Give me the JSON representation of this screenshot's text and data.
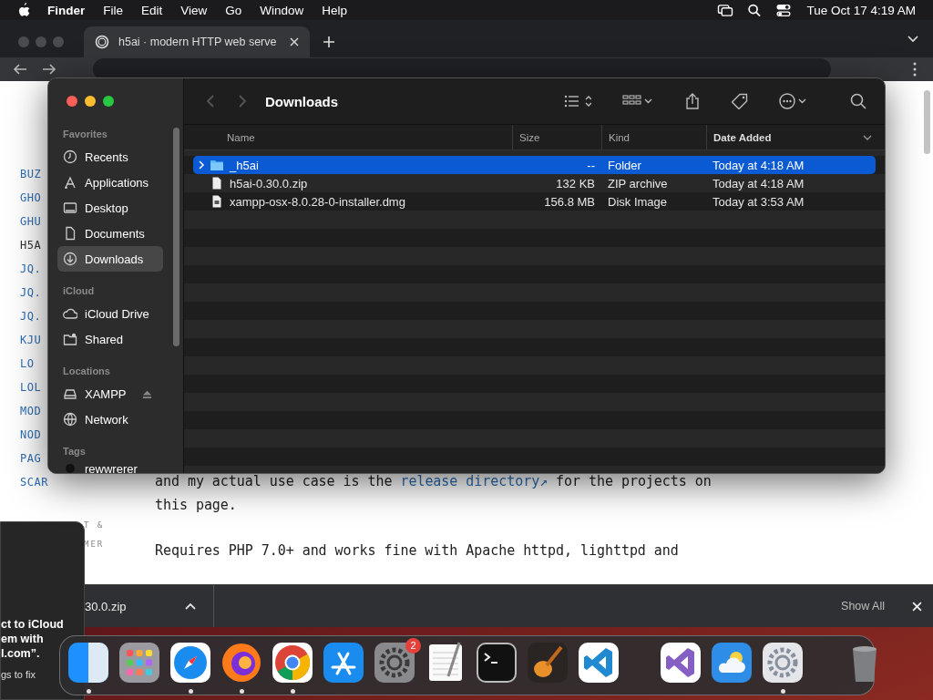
{
  "menubar": {
    "app": "Finder",
    "menus": [
      "File",
      "Edit",
      "View",
      "Go",
      "Window",
      "Help"
    ],
    "clock": "Tue Oct 17  4:19 AM"
  },
  "browser": {
    "tabs": [
      {
        "title": "h5ai · modern HTTP web serve",
        "selected": true
      }
    ],
    "nav_links": [
      {
        "label": "BUZ",
        "selected": false
      },
      {
        "label": "GHO",
        "selected": false
      },
      {
        "label": "GHU",
        "selected": false
      },
      {
        "label": "H5A",
        "selected": true
      },
      {
        "label": "JQ.",
        "selected": false
      },
      {
        "label": "JQ.",
        "selected": false
      },
      {
        "label": "JQ.",
        "selected": false
      },
      {
        "label": "KJU",
        "selected": false
      },
      {
        "label": "LO",
        "selected": false
      },
      {
        "label": "LOL",
        "selected": false
      },
      {
        "label": "MOD",
        "selected": false
      },
      {
        "label": "NOD",
        "selected": false
      },
      {
        "label": "PAG",
        "selected": false
      },
      {
        "label": "SCAR",
        "selected": false
      }
    ],
    "footer_links": [
      "T &",
      "MER"
    ],
    "paragraphs": [
      {
        "before": "and my actual use case is the ",
        "link": "release directory↗",
        "after": " for the projects on this page."
      },
      {
        "before": "Requires PHP 7.0+ and works fine with Apache httpd, lighttpd and"
      }
    ],
    "download_bar": {
      "file": "30.0.zip",
      "show_all": "Show All"
    }
  },
  "finder": {
    "title": "Downloads",
    "sidebar": [
      {
        "heading": "Favorites",
        "items": [
          {
            "label": "Recents",
            "kind": "recents",
            "selected": false
          },
          {
            "label": "Applications",
            "kind": "applications",
            "selected": false
          },
          {
            "label": "Desktop",
            "kind": "desktop",
            "selected": false
          },
          {
            "label": "Documents",
            "kind": "documents",
            "selected": false
          },
          {
            "label": "Downloads",
            "kind": "downloads",
            "selected": true
          }
        ]
      },
      {
        "heading": "iCloud",
        "items": [
          {
            "label": "iCloud Drive",
            "kind": "cloud",
            "selected": false
          },
          {
            "label": "Shared",
            "kind": "shared",
            "selected": false
          }
        ]
      },
      {
        "heading": "Locations",
        "items": [
          {
            "label": "XAMPP",
            "kind": "drive",
            "selected": false,
            "eject": true
          },
          {
            "label": "Network",
            "kind": "network",
            "selected": false
          }
        ]
      },
      {
        "heading": "Tags",
        "items": [
          {
            "label": "rewwrerer",
            "kind": "tag",
            "selected": false,
            "color": "#111111"
          }
        ]
      }
    ],
    "columns": [
      {
        "label": "Name",
        "sorted": false
      },
      {
        "label": "Size",
        "sorted": false
      },
      {
        "label": "Kind",
        "sorted": false
      },
      {
        "label": "Date Added",
        "sorted": true
      }
    ],
    "rows": [
      {
        "name": "_h5ai",
        "size": "--",
        "kind_text": "Folder",
        "date": "Today at 4:18 AM",
        "kind": "folder",
        "selected": true,
        "expandable": true
      },
      {
        "name": "h5ai-0.30.0.zip",
        "size": "132 KB",
        "kind_text": "ZIP archive",
        "date": "Today at 4:18 AM",
        "kind": "file",
        "selected": false,
        "expandable": false
      },
      {
        "name": "xampp-osx-8.0.28-0-installer.dmg",
        "size": "156.8 MB",
        "kind_text": "Disk Image",
        "date": "Today at 3:53 AM",
        "kind": "disk",
        "selected": false,
        "expandable": false
      }
    ]
  },
  "notification": {
    "lines": [
      "ct to iCloud",
      "em with",
      "l.com”."
    ],
    "hint": "gs to fix"
  },
  "dock": [
    {
      "kind": "finder",
      "running": true
    },
    {
      "kind": "launchpad",
      "running": false
    },
    {
      "kind": "safari",
      "running": true
    },
    {
      "kind": "firefox",
      "running": true
    },
    {
      "kind": "chrome",
      "running": true
    },
    {
      "kind": "appstore",
      "running": false
    },
    {
      "kind": "settings",
      "running": false,
      "badge": "2"
    },
    {
      "kind": "textedit",
      "running": false
    },
    {
      "kind": "terminal",
      "running": false
    },
    {
      "kind": "garageband",
      "running": false
    },
    {
      "kind": "vscode",
      "running": false
    },
    {
      "kind": "divider"
    },
    {
      "kind": "visualstudio",
      "running": false
    },
    {
      "kind": "weather",
      "running": false
    },
    {
      "kind": "preferences",
      "running": true
    },
    {
      "kind": "divider"
    },
    {
      "kind": "trash",
      "running": false
    }
  ]
}
